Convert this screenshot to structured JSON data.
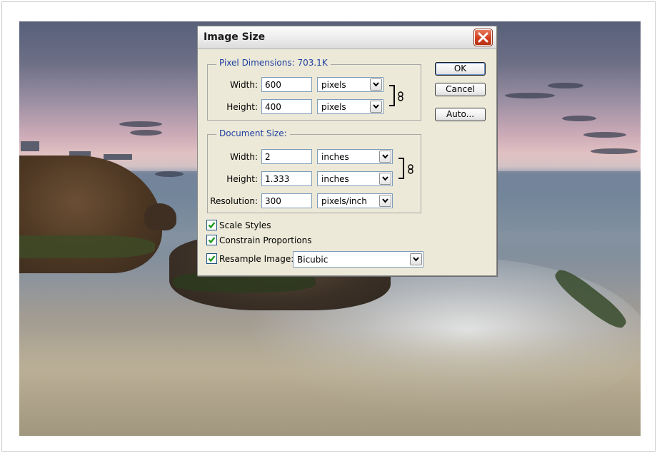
{
  "dialog": {
    "title": "Image Size",
    "pixel_dimensions": {
      "legend": "Pixel Dimensions:  703.1K",
      "width_label": "Width:",
      "width_value": "600",
      "width_unit": "pixels",
      "height_label": "Height:",
      "height_value": "400",
      "height_unit": "pixels"
    },
    "document_size": {
      "legend": "Document Size:",
      "width_label": "Width:",
      "width_value": "2",
      "width_unit": "inches",
      "height_label": "Height:",
      "height_value": "1.333",
      "height_unit": "inches",
      "resolution_label": "Resolution:",
      "resolution_value": "300",
      "resolution_unit": "pixels/inch"
    },
    "buttons": {
      "ok": "OK",
      "cancel": "Cancel",
      "auto": "Auto..."
    },
    "options": {
      "scale_styles": {
        "label": "Scale Styles",
        "checked": true
      },
      "constrain_proportions": {
        "label": "Constrain Proportions",
        "checked": true
      },
      "resample_image": {
        "label": "Resample Image:",
        "checked": true,
        "method": "Bicubic"
      }
    }
  },
  "colors": {
    "dialog_bg": "#ece9d8",
    "legend_text": "#1f3fa0",
    "close_button": "#d0401f",
    "check_mark": "#1e9a1e",
    "input_border": "#7f9db9"
  },
  "icons": [
    "close-icon",
    "chevron-down-icon",
    "chain-link-icon",
    "checkmark-icon"
  ]
}
